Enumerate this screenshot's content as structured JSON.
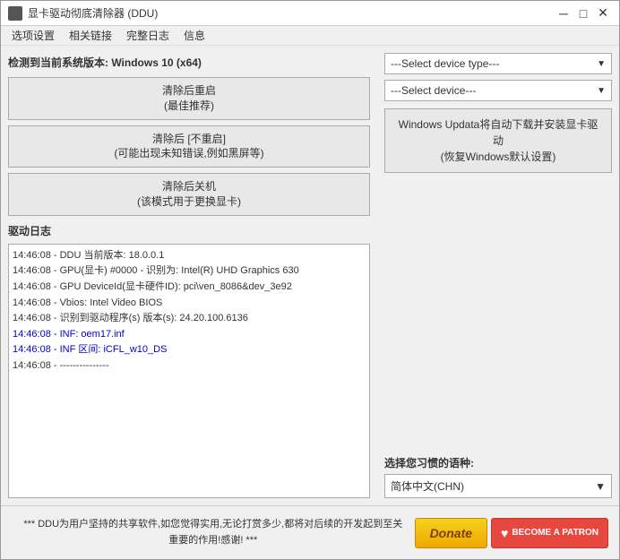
{
  "window": {
    "title": "显卡驱动彻底清除器 (DDU)",
    "icon": "monitor-icon"
  },
  "menu": {
    "items": [
      "选项设置",
      "相关链接",
      "完整日志",
      "信息"
    ]
  },
  "left": {
    "system_info": "检测到当前系统版本: Windows 10 (x64)",
    "buttons": [
      {
        "label": "清除后重启\n(最佳推荐)"
      },
      {
        "label": "清除后 [不重启]\n(可能出现未知错误,例如黑屏等)"
      },
      {
        "label": "清除后关机\n(该模式用于更换显卡)"
      }
    ],
    "log_label": "驱动日志",
    "log_lines": [
      {
        "text": "14:46:08 - DDU 当前版本: 18.0.0.1",
        "style": "normal"
      },
      {
        "text": "14:46:08 - GPU(显卡) #0000 - 识别为: Intel(R) UHD Graphics 630",
        "style": "normal"
      },
      {
        "text": "14:46:08 - GPU DeviceId(显卡硬件ID): pci\\ven_8086&dev_3e92",
        "style": "normal"
      },
      {
        "text": "14:46:08 - Vbios: Intel Video BIOS",
        "style": "normal"
      },
      {
        "text": "14:46:08 - 识别到驱动程序(s) 版本(s): 24.20.100.6136",
        "style": "normal"
      },
      {
        "text": "14:46:08 - INF: oem17.inf",
        "style": "blue"
      },
      {
        "text": "14:46:08 - INF 区间: iCFL_w10_DS",
        "style": "blue"
      },
      {
        "text": "14:46:08 - ---------------",
        "style": "normal"
      }
    ]
  },
  "right": {
    "select_device_type": "---Select device type---",
    "select_device": "---Select device---",
    "windows_update_btn": "Windows Updata将自动下载并安装显\n卡驱动\n(恢复Windows默认设置)",
    "language_label": "选择您习惯的语种:",
    "language_value": "简体中文(CHN)"
  },
  "footer": {
    "text_line1": "*** DDU为用户坚持的共享软件,如您觉得实用,无论打赏多少,都将对后续的开发起到至关",
    "text_line2": "重要的作用!感谢! ***",
    "donate_label": "Donate",
    "patron_label": "BECOME A PATRON",
    "patron_icon": "♥"
  }
}
